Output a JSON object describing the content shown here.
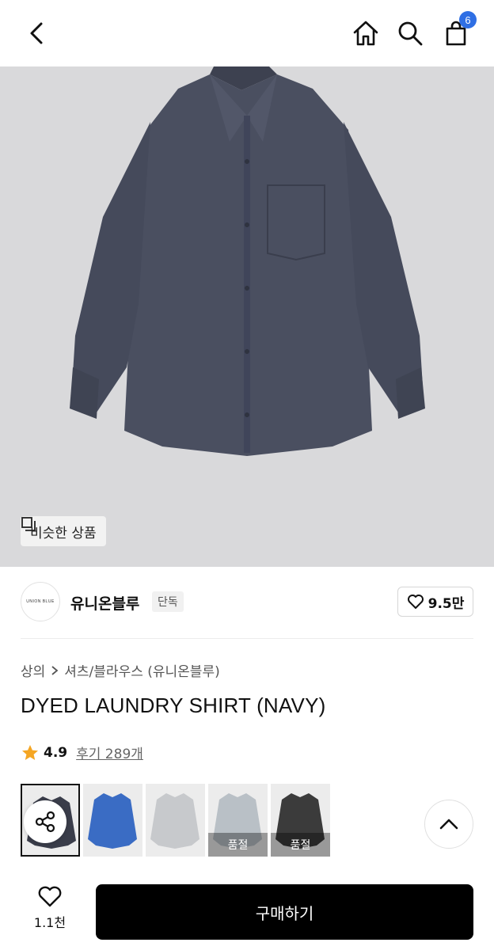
{
  "header": {
    "cart_count": "6"
  },
  "hero": {
    "similar_label": "비슷한 상품"
  },
  "brand": {
    "logo_text": "UNION BLUE",
    "name": "유니온블루",
    "tag": "단독",
    "likes": "9.5만"
  },
  "product": {
    "breadcrumb": [
      "상의",
      "셔츠/블라우스 (유니온블루)"
    ],
    "title": "DYED LAUNDRY SHIRT (NAVY)",
    "rating": "4.9",
    "reviews_label": "후기 289개"
  },
  "variants": [
    {
      "name": "navy",
      "color": "#3a3d4a",
      "soldout_label": ""
    },
    {
      "name": "blue",
      "color": "#3a6cc4",
      "soldout_label": ""
    },
    {
      "name": "gray",
      "color": "#c7c9cc",
      "soldout_label": ""
    },
    {
      "name": "light-gray",
      "color": "#b9c0c6",
      "soldout_label": "품절"
    },
    {
      "name": "black",
      "color": "#3b3b3b",
      "soldout_label": "품절"
    }
  ],
  "bottom": {
    "wish_count": "1.1천",
    "buy_label": "구매하기"
  },
  "colors": {
    "accent": "#2f6fe4",
    "star": "#f5a623",
    "shirt": "#4a4f60"
  }
}
